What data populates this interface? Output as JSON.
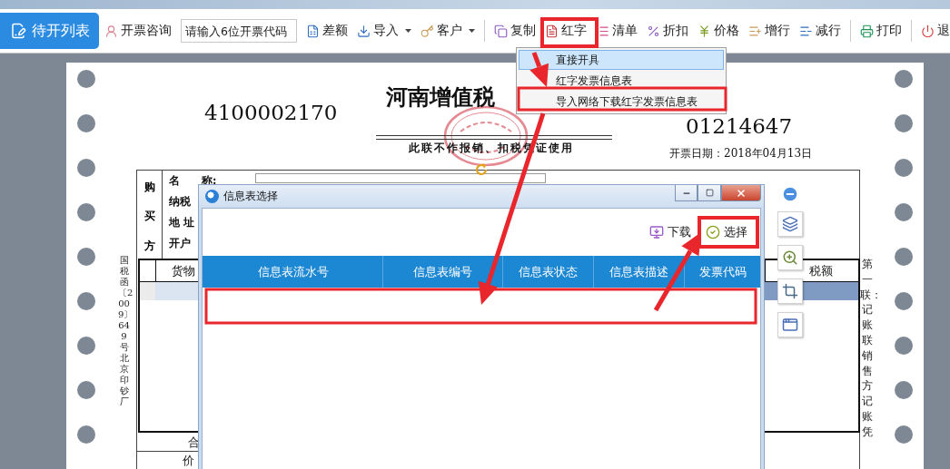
{
  "toolbar": {
    "primary_button": "待开列表",
    "items": [
      {
        "kind": "button",
        "label": "开票咨询"
      },
      {
        "kind": "field",
        "placeholder": "请输入6位开票代码"
      },
      {
        "kind": "button",
        "label": "差额"
      },
      {
        "kind": "dropdown",
        "label": "导入"
      },
      {
        "kind": "dropdown",
        "label": "客户"
      },
      {
        "kind": "separator"
      },
      {
        "kind": "button",
        "label": "复制"
      },
      {
        "kind": "button",
        "label": "红字"
      },
      {
        "kind": "button",
        "label": "清单"
      },
      {
        "kind": "button",
        "label": "折扣"
      },
      {
        "kind": "button",
        "label": "价格"
      },
      {
        "kind": "button",
        "label": "增行"
      },
      {
        "kind": "button",
        "label": "减行"
      },
      {
        "kind": "separator"
      },
      {
        "kind": "button",
        "label": "打印"
      },
      {
        "kind": "separator"
      },
      {
        "kind": "button",
        "label": "退"
      }
    ]
  },
  "red_word_menu": {
    "items": [
      {
        "label": "直接开具",
        "selected": true
      },
      {
        "label": "红字发票信息表",
        "selected": false
      },
      {
        "label": "导入网络下载红字发票信息表",
        "selected": false
      }
    ]
  },
  "invoice": {
    "code": "4100002170",
    "title": "河南增值税",
    "notice": "此联不作报销、扣税凭证使用",
    "number": "01214647",
    "issue_date": "开票日期：2018年04月13日",
    "buyer_heading": "购买方",
    "buyer_labels": [
      "名　　称:",
      "纳税",
      "地 址",
      "开户"
    ],
    "goods_header_left": "货物",
    "goods_header_right": "税额",
    "goods_rows": [
      {
        "selected": true
      }
    ],
    "total_label": "合",
    "price_total_label": "价",
    "form_note": "国税函〔2009〕649号北京印钞厂",
    "copy_note": "第一联：记账联销售方记账凭"
  },
  "dialog": {
    "title": "信息表选择",
    "actions": [
      {
        "label": "下载"
      },
      {
        "label": "选择"
      }
    ],
    "columns": [
      "信息表流水号",
      "信息表编号",
      "信息表状态",
      "信息表描述",
      "发票代码"
    ]
  }
}
